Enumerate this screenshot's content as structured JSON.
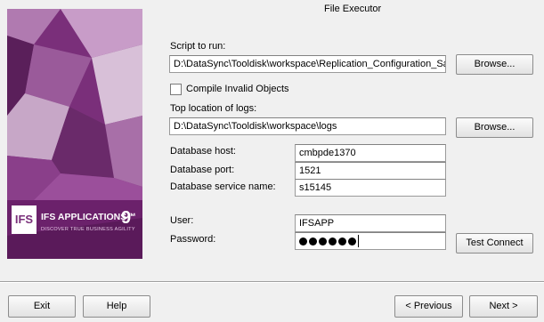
{
  "window": {
    "title": "File Executor"
  },
  "brand": {
    "logo_text": "IFS",
    "product_name": "IFS APPLICATIONS™",
    "version": "9",
    "tagline": "DISCOVER TRUE BUSINESS AGILITY"
  },
  "form": {
    "script_label": "Script to run:",
    "script_value": "D:\\DataSync\\Tooldisk\\workspace\\Replication_Configuration_Sa",
    "browse_label": "Browse...",
    "compile_label": "Compile Invalid Objects",
    "compile_checked": false,
    "logs_label": "Top location of logs:",
    "logs_value": "D:\\DataSync\\Tooldisk\\workspace\\logs",
    "db_host_label": "Database host:",
    "db_host_value": "cmbpde1370",
    "db_port_label": "Database port:",
    "db_port_value": "1521",
    "db_service_label": "Database service name:",
    "db_service_value": "s15145",
    "user_label": "User:",
    "user_value": "IFSAPP",
    "password_label": "Password:",
    "password_mask_length": 6,
    "test_connect_label": "Test Connect"
  },
  "footer": {
    "exit_label": "Exit",
    "help_label": "Help",
    "previous_label": "< Previous",
    "next_label": "Next >"
  },
  "colors": {
    "banner": "#7a2f7a",
    "background": "#f0f0f0"
  }
}
